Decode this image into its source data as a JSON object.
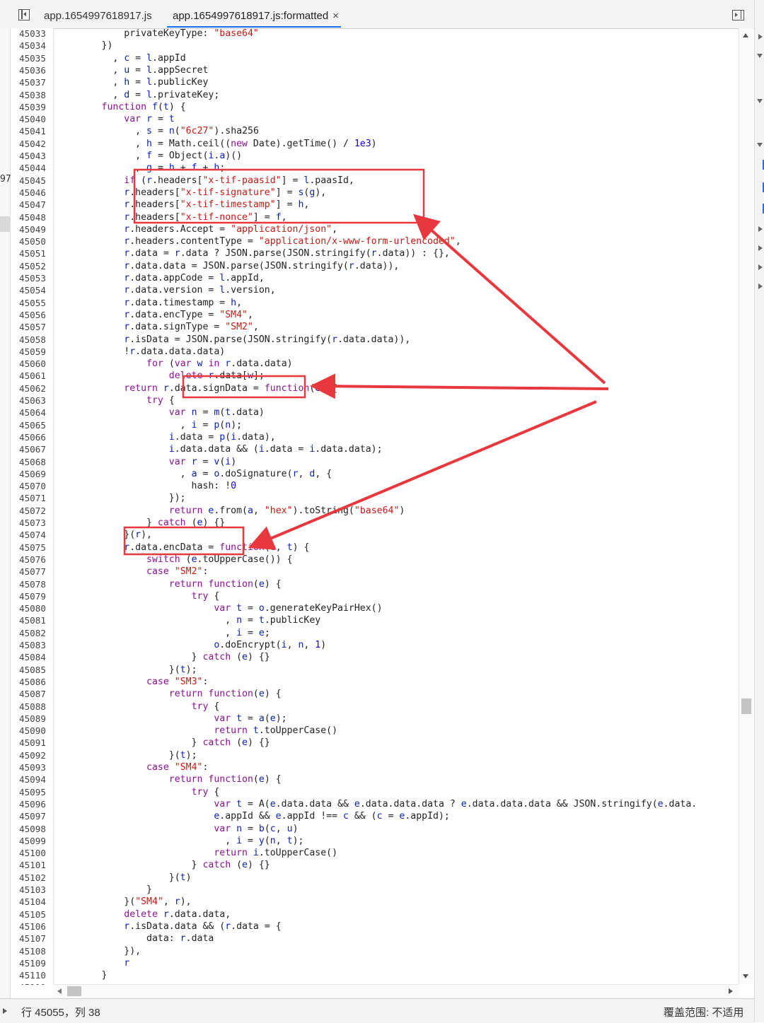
{
  "tabs": [
    {
      "label": "app.1654997618917.js"
    },
    {
      "label": "app.1654997618917.js:formatted",
      "close": "×"
    }
  ],
  "left_strip_label": "97",
  "status": {
    "position": "行 45055，列 38",
    "coverage": "覆盖范围: 不适用"
  },
  "first_line_number": 45033,
  "code_lines": [
    "            privateKeyType: \"base64\"",
    "        })",
    "          , c = l.appId",
    "          , u = l.appSecret",
    "          , h = l.publicKey",
    "          , d = l.privateKey;",
    "        function f(t) {",
    "            var r = t",
    "              , s = n(\"6c27\").sha256",
    "              , h = Math.ceil((new Date).getTime() / 1e3)",
    "              , f = Object(i.a)()",
    "              , g = h + f + h;",
    "            if (r.headers[\"x-tif-paasid\"] = l.paasId,",
    "            r.headers[\"x-tif-signature\"] = s(g),",
    "            r.headers[\"x-tif-timestamp\"] = h,",
    "            r.headers[\"x-tif-nonce\"] = f,",
    "            r.headers.Accept = \"application/json\",",
    "            r.headers.contentType = \"application/x-www-form-urlencoded\",",
    "            r.data = r.data ? JSON.parse(JSON.stringify(r.data)) : {},",
    "            r.data.data = JSON.parse(JSON.stringify(r.data)),",
    "            r.data.appCode = l.appId,",
    "            r.data.version = l.version,",
    "            r.data.timestamp = h,",
    "            r.data.encType = \"SM4\",",
    "            r.data.signType = \"SM2\",",
    "            r.isData = JSON.parse(JSON.stringify(r.data.data)),",
    "            !r.data.data.data)",
    "                for (var w in r.data.data)",
    "                    delete r.data[w];",
    "            return r.data.signData = function(e) {",
    "                try {",
    "                    var n = m(t.data)",
    "                      , i = p(n);",
    "                    i.data = p(i.data),",
    "                    i.data.data && (i.data = i.data.data);",
    "                    var r = v(i)",
    "                      , a = o.doSignature(r, d, {",
    "                        hash: !0",
    "                    });",
    "                    return e.from(a, \"hex\").toString(\"base64\")",
    "                } catch (e) {}",
    "            }(r),",
    "            r.data.encData = function(e, t) {",
    "                switch (e.toUpperCase()) {",
    "                case \"SM2\":",
    "                    return function(e) {",
    "                        try {",
    "                            var t = o.generateKeyPairHex()",
    "                              , n = t.publicKey",
    "                              , i = e;",
    "                            o.doEncrypt(i, n, 1)",
    "                        } catch (e) {}",
    "                    }(t);",
    "                case \"SM3\":",
    "                    return function(e) {",
    "                        try {",
    "                            var t = a(e);",
    "                            return t.toUpperCase()",
    "                        } catch (e) {}",
    "                    }(t);",
    "                case \"SM4\":",
    "                    return function(e) {",
    "                        try {",
    "                            var t = A(e.data.data && e.data.data.data ? e.data.data.data && JSON.stringify(e.data.",
    "                            e.appId && e.appId !== c && (c = e.appId);",
    "                            var n = b(c, u)",
    "                              , i = y(n, t);",
    "                            return i.toUpperCase()",
    "                        } catch (e) {}",
    "                    }(t)",
    "                }",
    "            }(\"SM4\", r),",
    "            delete r.data.data,",
    "            r.isData.data && (r.data = {",
    "                data: r.data",
    "            }),",
    "            r",
    "        }"
  ],
  "annotation_color": "#e8383d"
}
